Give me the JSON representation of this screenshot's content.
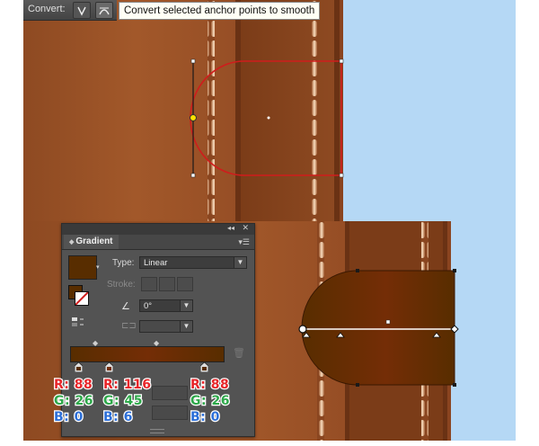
{
  "control_bar": {
    "convert_label": "Convert:",
    "tooltip": "Convert selected anchor points to smooth",
    "buttons": [
      "convert-to-corner-icon",
      "convert-to-smooth-icon"
    ]
  },
  "gradient_panel": {
    "title": "Gradient",
    "type_label": "Type:",
    "type_value": "Linear",
    "stroke_label": "Stroke:",
    "angle_value": "0°",
    "gradient_start_color": "#582d00",
    "gradient_mid_color": "#742d06",
    "gradient_end_color": "#582d00"
  },
  "stops": [
    {
      "r_label": "R: 88",
      "g_label": "G: 26",
      "b_label": "B: 0"
    },
    {
      "r_label": "R: 116",
      "g_label": "G: 45",
      "b_label": "B: 6"
    },
    {
      "r_label": "R: 88",
      "g_label": "G: 26",
      "b_label": "B: 0"
    }
  ],
  "colors": {
    "leather": "#8b4a22",
    "stitch": "#f5cfa8",
    "path_red": "#d01c1c",
    "canvas_bg": "#b5d8f5"
  }
}
